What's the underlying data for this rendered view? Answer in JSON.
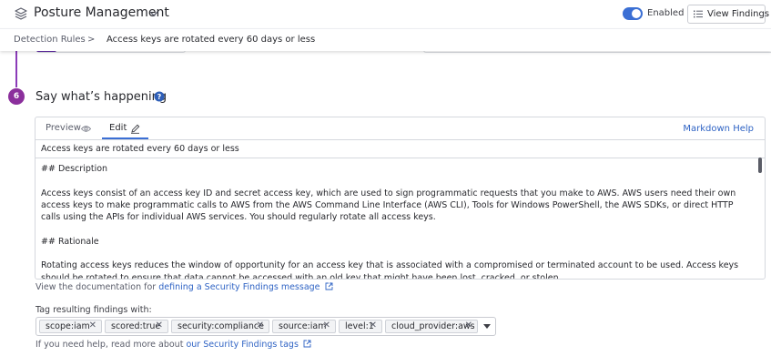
{
  "header": {
    "title": "Posture Management",
    "toggle_label": "Enabled",
    "toggle_on": true,
    "view_button": "View Findings"
  },
  "breadcrumb": {
    "items": [
      "Detection Rules",
      "Access keys are rotated every 60 days or less"
    ],
    "separator": ">"
  },
  "step": {
    "number": "6",
    "title": "Say what’s happening"
  },
  "editor": {
    "tabs": {
      "preview": "Preview",
      "edit": "Edit"
    },
    "active_tab": "Edit",
    "markdown_help": "Markdown Help",
    "title_value": "Access keys are rotated every 60 days or less",
    "body": {
      "heading1": "## Description",
      "para1": "Access keys consist of an access key ID and secret access key, which are used to sign programmatic requests that you make to AWS. AWS users need their own access keys to make programmatic calls to AWS from the AWS Command Line Interface (AWS CLI), Tools for Windows PowerShell, the AWS SDKs, or direct HTTP calls using the APIs for individual AWS services. You should regularly rotate all access keys.",
      "heading2": "## Rationale",
      "para2": "Rotating access keys reduces the window of opportunity for an access key that is associated with a compromised or terminated account to be used. Access keys should be rotated to ensure that data cannot be accessed with an old key that might have been lost, cracked, or stolen."
    }
  },
  "documentation": {
    "prefix": "View the documentation for ",
    "link": "defining a Security Findings message"
  },
  "tags": {
    "label": "Tag resulting findings with:",
    "items": [
      "scope:iam",
      "scored:true",
      "security:compliance",
      "source:iam",
      "level:1",
      "cloud_provider:aws"
    ]
  },
  "help": {
    "prefix": "If you need help, read more about ",
    "link": "our Security Findings tags"
  },
  "colors": {
    "accent": "#3b6fd4",
    "link": "#2f63c4",
    "step_badge": "#8b2f9c"
  },
  "icons": [
    "posture-management-icon",
    "chevron-down-icon",
    "list-icon",
    "question-circle-icon",
    "eye-icon",
    "pencil-icon",
    "external-link-icon",
    "close-icon",
    "caret-down-icon"
  ]
}
